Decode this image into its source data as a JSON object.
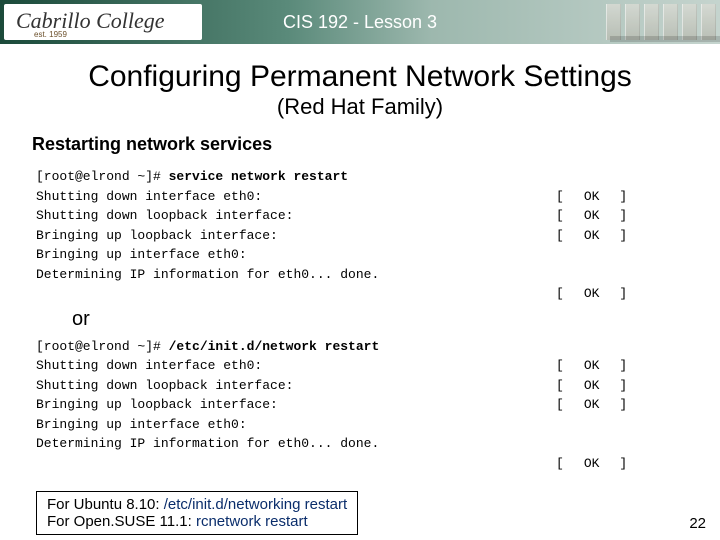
{
  "header": {
    "logo_name": "Cabrillo College",
    "logo_est": "est. 1959",
    "title": "CIS 192 - Lesson 3"
  },
  "main": {
    "title": "Configuring Permanent Network Settings",
    "subtitle": "(Red Hat Family)",
    "section": "Restarting network services",
    "or": "or"
  },
  "term1": {
    "prompt": "[root@elrond ~]# ",
    "command": "service network restart",
    "lines": [
      "Shutting down interface eth0:",
      "Shutting down loopback interface:",
      "Bringing up loopback interface:",
      "Bringing up interface eth0:",
      "Determining IP information for eth0... done."
    ]
  },
  "term2": {
    "prompt": "[root@elrond ~]# ",
    "command": "/etc/init.d/network restart",
    "lines": [
      "Shutting down interface eth0:",
      "Shutting down loopback interface:",
      "Bringing up loopback interface:",
      "Bringing up interface eth0:",
      "Determining IP information for eth0... done."
    ]
  },
  "status": {
    "lb": "[",
    "ok": "OK",
    "rb": "]"
  },
  "notes": {
    "l1_label": "For Ubuntu 8.10:  ",
    "l1_cmd": "/etc/init.d/networking restart",
    "l2_label": "For Open.SUSE 11.1: ",
    "l2_cmd": "rcnetwork restart"
  },
  "page": "22"
}
